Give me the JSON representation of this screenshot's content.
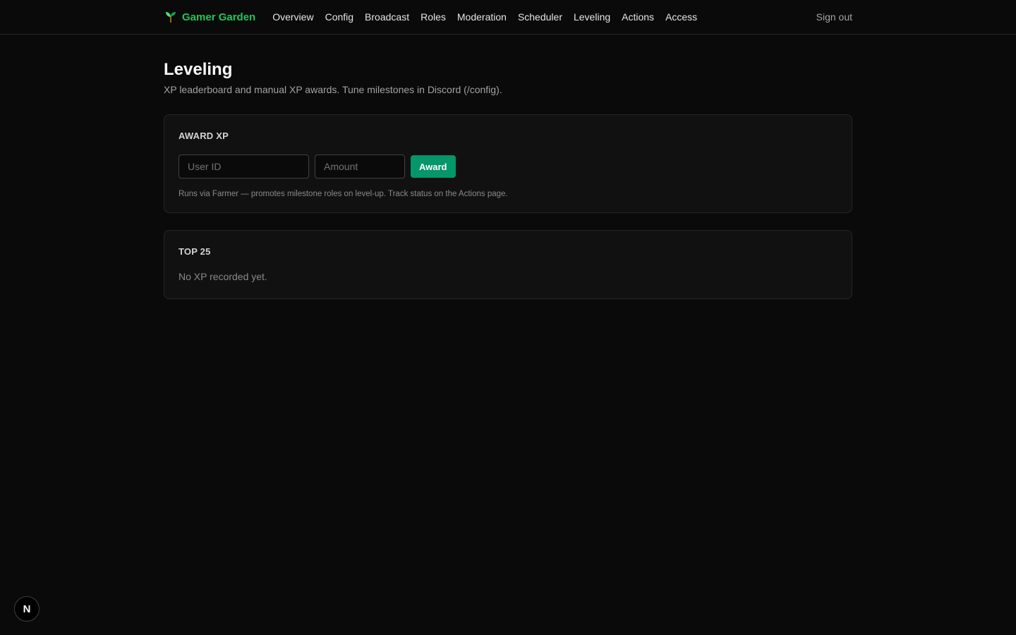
{
  "brand": {
    "name": "Gamer Garden",
    "icon": "seedling-icon",
    "color": "#22c55e"
  },
  "nav": {
    "items": [
      {
        "label": "Overview"
      },
      {
        "label": "Config"
      },
      {
        "label": "Broadcast"
      },
      {
        "label": "Roles"
      },
      {
        "label": "Moderation"
      },
      {
        "label": "Scheduler"
      },
      {
        "label": "Leveling"
      },
      {
        "label": "Actions"
      },
      {
        "label": "Access"
      }
    ],
    "signout_label": "Sign out"
  },
  "page": {
    "title": "Leveling",
    "subtitle": "XP leaderboard and manual XP awards. Tune milestones in Discord (/config)."
  },
  "award": {
    "title": "AWARD XP",
    "user_placeholder": "User ID",
    "user_value": "",
    "amount_placeholder": "Amount",
    "amount_value": "",
    "button_label": "Award",
    "button_color": "#059669",
    "hint": "Runs via Farmer — promotes milestone roles on level-up. Track status on the Actions page."
  },
  "leaderboard": {
    "title": "TOP 25",
    "empty_text": "No XP recorded yet."
  },
  "dev_badge": {
    "label": "N"
  }
}
